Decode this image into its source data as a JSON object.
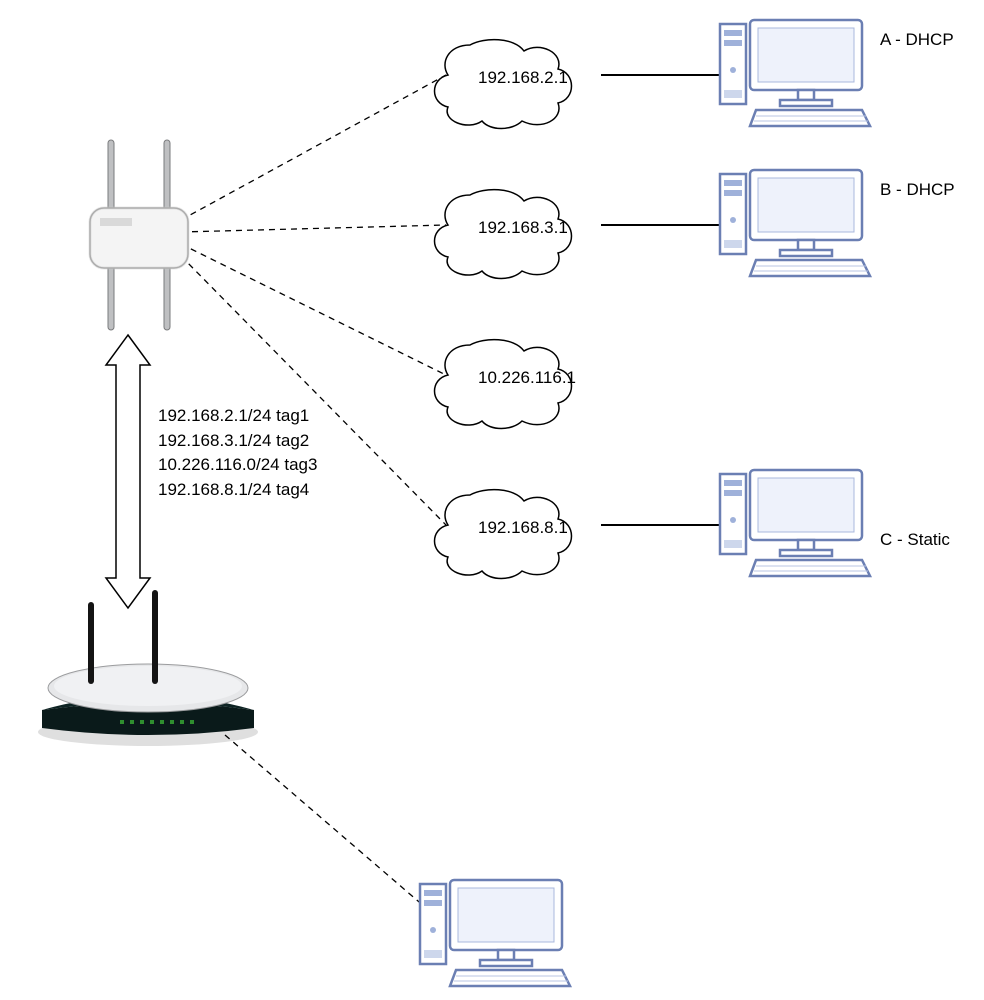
{
  "clouds": [
    {
      "ip": "192.168.2.1"
    },
    {
      "ip": "192.168.3.1"
    },
    {
      "ip": "10.226.116.1"
    },
    {
      "ip": "192.168.8.1"
    }
  ],
  "hosts": {
    "a": "A - DHCP",
    "b": "B - DHCP",
    "c": "C - Static"
  },
  "trunk": {
    "l1": "192.168.2.1/24 tag1",
    "l2": "192.168.3.1/24 tag2",
    "l3": "10.226.116.0/24 tag3",
    "l4": "192.168.8.1/24 tag4"
  }
}
